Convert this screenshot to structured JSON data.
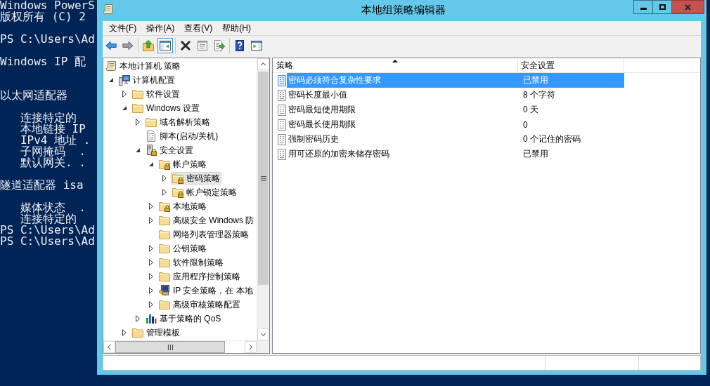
{
  "console": {
    "lines": [
      {
        "kind": "text",
        "text": "Windows PowerS"
      },
      {
        "kind": "text",
        "text": "版权所有 (C) 2"
      },
      {
        "kind": "blank"
      },
      {
        "kind": "text",
        "text": "PS C:\\Users\\Ad"
      },
      {
        "kind": "blank"
      },
      {
        "kind": "text",
        "text": "Windows IP 配"
      },
      {
        "kind": "blank"
      },
      {
        "kind": "blank"
      },
      {
        "kind": "text",
        "text": "以太网适配器"
      },
      {
        "kind": "blank"
      },
      {
        "kind": "indented",
        "text": "连接特定的"
      },
      {
        "kind": "indented",
        "text": "本地链接 IP"
      },
      {
        "kind": "indented",
        "text": "IPv4 地址 ."
      },
      {
        "kind": "indented",
        "text": "子网掩码  ."
      },
      {
        "kind": "indented",
        "text": "默认网关. ."
      },
      {
        "kind": "blank"
      },
      {
        "kind": "text",
        "text": "隧道适配器 isa"
      },
      {
        "kind": "blank"
      },
      {
        "kind": "indented",
        "text": "媒体状态  ."
      },
      {
        "kind": "indented",
        "text": "连接特定的"
      },
      {
        "kind": "text",
        "text": "PS C:\\Users\\Ad"
      },
      {
        "kind": "text",
        "text": "PS C:\\Users\\Ad"
      }
    ]
  },
  "window": {
    "title": "本地组策略编辑器",
    "menu": [
      "文件(F)",
      "操作(A)",
      "查看(V)",
      "帮助(H)"
    ],
    "toolbar": {
      "groups": [
        {
          "buttons": [
            {
              "kind": "back",
              "disabled": false,
              "pressed": false
            },
            {
              "kind": "forward",
              "disabled": true,
              "pressed": false
            }
          ]
        },
        {
          "buttons": [
            {
              "kind": "up-folder",
              "disabled": false,
              "pressed": false
            },
            {
              "kind": "console-tree",
              "disabled": false,
              "pressed": true
            }
          ]
        },
        {
          "buttons": [
            {
              "kind": "delete",
              "disabled": false,
              "pressed": false
            },
            {
              "kind": "properties",
              "disabled": false,
              "pressed": false
            },
            {
              "kind": "export",
              "disabled": false,
              "pressed": false
            }
          ]
        },
        {
          "buttons": [
            {
              "kind": "help",
              "disabled": false,
              "pressed": false
            },
            {
              "kind": "action-pane",
              "disabled": false,
              "pressed": false
            }
          ]
        }
      ]
    },
    "tree": {
      "items": [
        {
          "label": "本地计算机 策略",
          "kind": "policy",
          "expandable": false,
          "selected": false,
          "children": [
            {
              "label": "计算机配置",
              "kind": "computer",
              "expandable": true,
              "expanded": true,
              "selected": false,
              "children": [
                {
                  "label": "软件设置",
                  "kind": "folder",
                  "expandable": true,
                  "expanded": false,
                  "selected": false
                },
                {
                  "label": "Windows 设置",
                  "kind": "folder",
                  "expandable": true,
                  "expanded": true,
                  "selected": false,
                  "children": [
                    {
                      "label": "域名解析策略",
                      "kind": "folder",
                      "expandable": true,
                      "expanded": false,
                      "selected": false
                    },
                    {
                      "label": "脚本(启动/关机)",
                      "kind": "script",
                      "expandable": false,
                      "selected": false
                    },
                    {
                      "label": "安全设置",
                      "kind": "security",
                      "expandable": true,
                      "expanded": true,
                      "selected": false,
                      "children": [
                        {
                          "label": "帐户策略",
                          "kind": "locked-folder",
                          "expandable": true,
                          "expanded": true,
                          "selected": false,
                          "children": [
                            {
                              "label": "密码策略",
                              "kind": "locked-folder",
                              "expandable": true,
                              "expanded": false,
                              "selected": true
                            },
                            {
                              "label": "帐户锁定策略",
                              "kind": "locked-folder",
                              "expandable": true,
                              "expanded": false,
                              "selected": false
                            }
                          ]
                        },
                        {
                          "label": "本地策略",
                          "kind": "locked-folder",
                          "expandable": true,
                          "expanded": false,
                          "selected": false
                        },
                        {
                          "label": "高级安全 Windows 防",
                          "kind": "folder",
                          "expandable": true,
                          "expanded": false,
                          "selected": false
                        },
                        {
                          "label": "网络列表管理器策略",
                          "kind": "folder",
                          "expandable": false,
                          "selected": false
                        },
                        {
                          "label": "公钥策略",
                          "kind": "folder",
                          "expandable": true,
                          "expanded": false,
                          "selected": false
                        },
                        {
                          "label": "软件限制策略",
                          "kind": "folder",
                          "expandable": true,
                          "expanded": false,
                          "selected": false
                        },
                        {
                          "label": "应用程序控制策略",
                          "kind": "folder",
                          "expandable": true,
                          "expanded": false,
                          "selected": false
                        },
                        {
                          "label": "IP 安全策略，在 本地",
                          "kind": "ip-security",
                          "expandable": true,
                          "expanded": false,
                          "selected": false
                        },
                        {
                          "label": "高级审核策略配置",
                          "kind": "folder",
                          "expandable": true,
                          "expanded": false,
                          "selected": false
                        }
                      ]
                    },
                    {
                      "label": "基于策略的 QoS",
                      "kind": "qos",
                      "expandable": true,
                      "expanded": false,
                      "selected": false
                    }
                  ]
                },
                {
                  "label": "管理模板",
                  "kind": "folder",
                  "expandable": true,
                  "expanded": false,
                  "selected": false
                }
              ]
            }
          ]
        }
      ]
    },
    "list": {
      "columns": [
        {
          "label": "策略",
          "sorted": true
        },
        {
          "label": "安全设置",
          "sorted": false
        }
      ],
      "rows": [
        {
          "policy": "密码必须符合复杂性要求",
          "setting": "已禁用",
          "selected": true
        },
        {
          "policy": "密码长度最小值",
          "setting": "8 个字符",
          "selected": false
        },
        {
          "policy": "密码最短使用期限",
          "setting": "0 天",
          "selected": false
        },
        {
          "policy": "密码最长使用期限",
          "setting": "0",
          "selected": false
        },
        {
          "policy": "强制密码历史",
          "setting": "0 个记住的密码",
          "selected": false
        },
        {
          "policy": "用可还原的加密来储存密码",
          "setting": "已禁用",
          "selected": false
        }
      ]
    }
  }
}
